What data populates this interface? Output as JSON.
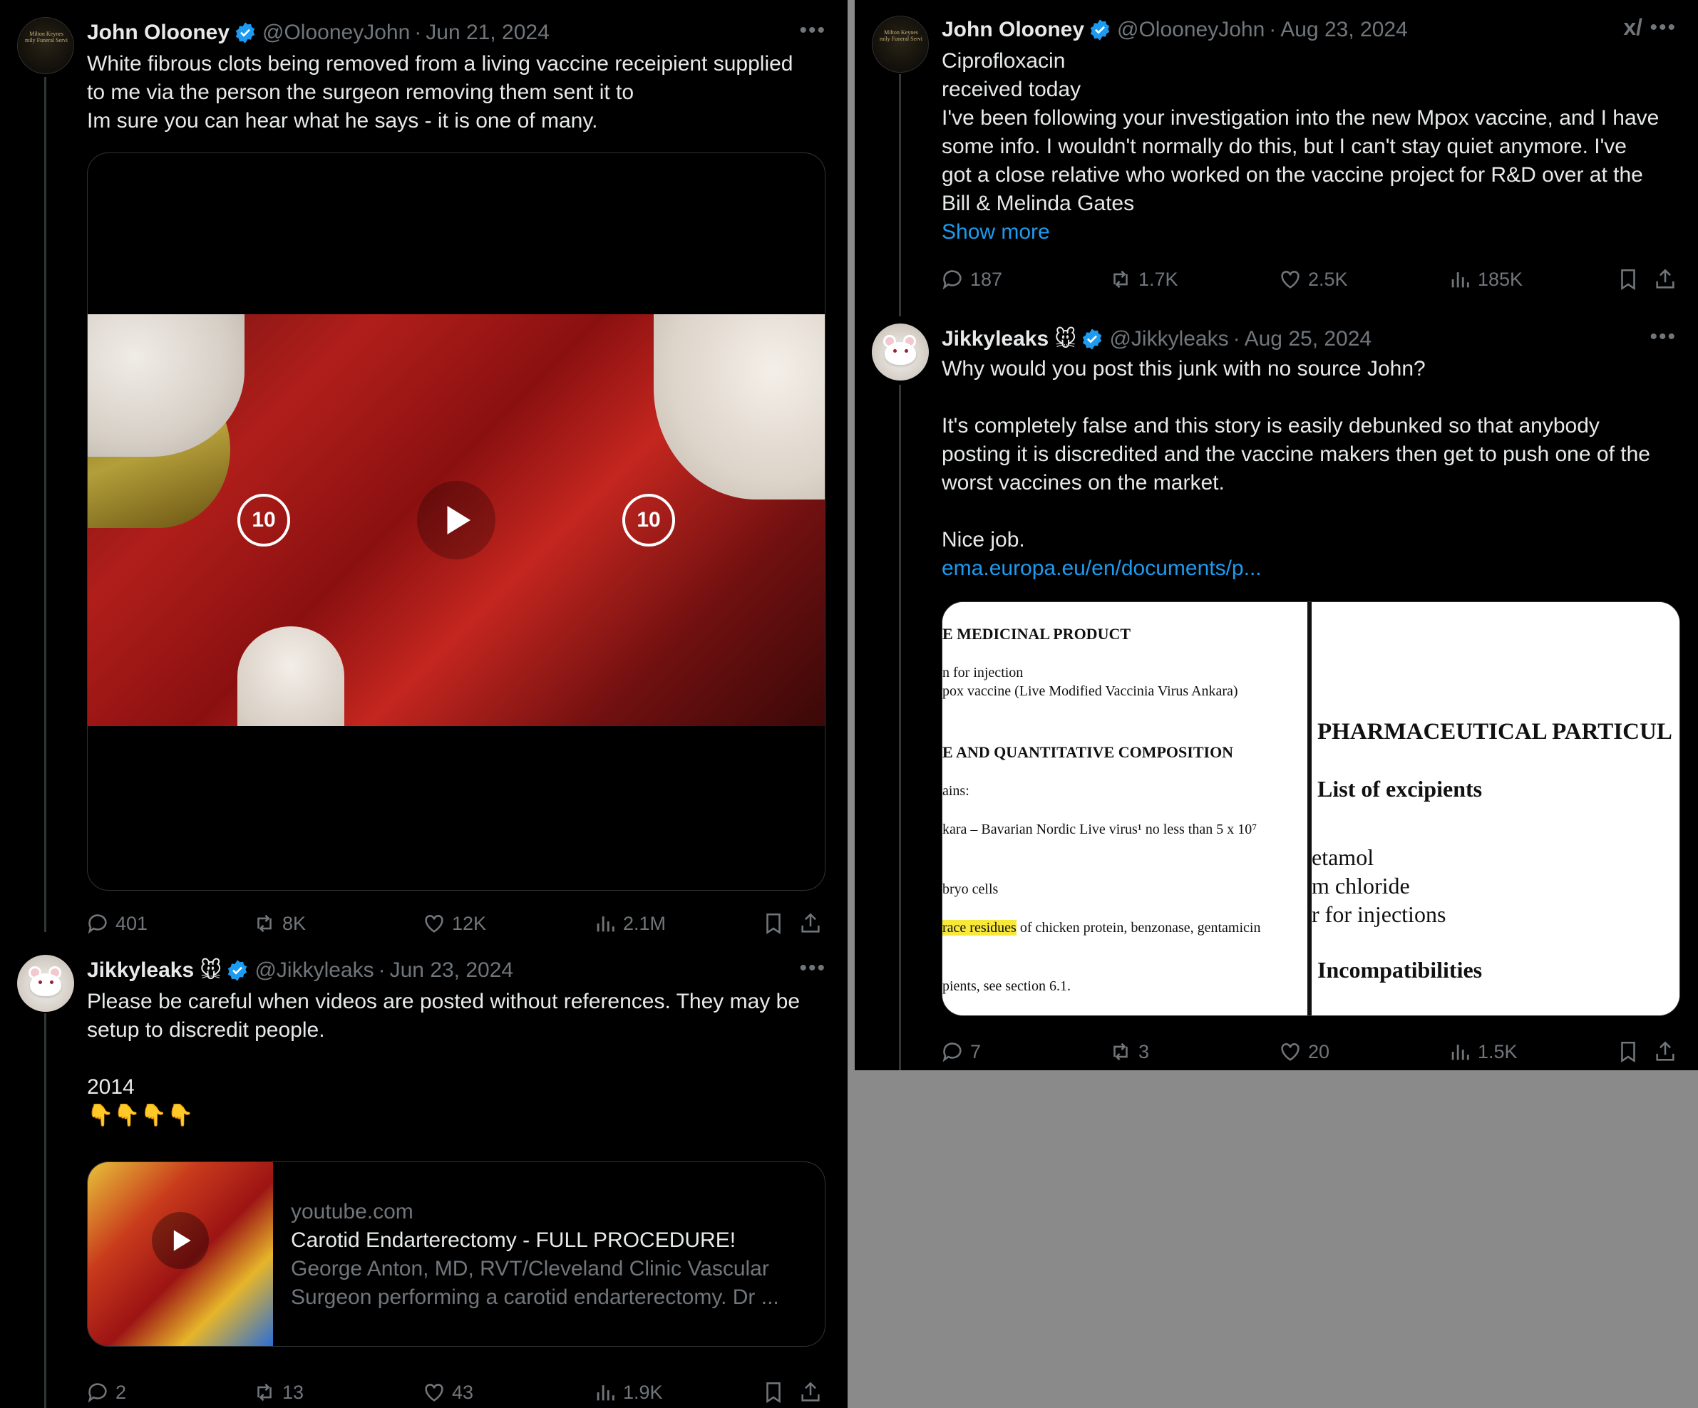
{
  "colors": {
    "background": "#000000",
    "text": "#e7e9ea",
    "muted": "#71767b",
    "link": "#1d9bf0",
    "verified": "#1d9bf0",
    "outside": "#8a8a8a"
  },
  "left": {
    "tweet1": {
      "name": "John Olooney",
      "handle": "@OlooneyJohn",
      "date": "Jun 21, 2024",
      "text": "White fibrous clots being removed from a living vaccine receipient supplied\nto me via the person the surgeon removing them sent it to\nIm sure you can hear what he says - it is one of many.",
      "video": {
        "rewind_label": "10",
        "forward_label": "10"
      },
      "stats": {
        "replies": "401",
        "reposts": "8K",
        "likes": "12K",
        "views": "2.1M"
      },
      "avatar_text": "Milton Keynes\nmily Funeral Servi"
    },
    "tweet2": {
      "name": "Jikkyleaks",
      "emoji": "🐭",
      "handle": "@Jikkyleaks",
      "date": "Jun 23, 2024",
      "text": "Please be careful when videos are posted without references. They may be\nsetup to discredit people.\n\n2014\n👇👇👇👇",
      "card": {
        "domain": "youtube.com",
        "title": "Carotid Endarterectomy - FULL PROCEDURE!",
        "description": "George Anton, MD, RVT/Cleveland Clinic Vascular\nSurgeon performing a carotid endarterectomy. Dr ..."
      },
      "stats": {
        "replies": "2",
        "reposts": "13",
        "likes": "43",
        "views": "1.9K"
      }
    }
  },
  "right": {
    "tweet1": {
      "name": "John Olooney",
      "handle": "@OlooneyJohn",
      "date": "Aug 23, 2024",
      "text": "Ciprofloxacin\nreceived today\nI've been following your investigation into the new Mpox vaccine, and I have\nsome info. I wouldn't normally do this, but I can't stay quiet anymore. I've\ngot a close relative who worked on the vaccine project for R&D over at the\nBill & Melinda Gates",
      "show_more": "Show more",
      "stats": {
        "replies": "187",
        "reposts": "1.7K",
        "likes": "2.5K",
        "views": "185K"
      }
    },
    "tweet2": {
      "name": "Jikkyleaks",
      "emoji": "🐭",
      "handle": "@Jikkyleaks",
      "date": "Aug 25, 2024",
      "text": "Why would you post this junk with no source John?\n\nIt's completely false and this story is easily debunked so that anybody\nposting it is discredited and the vaccine makers then get to push one of the\nworst vaccines on the market.\n\nNice job.",
      "link": "ema.europa.eu/en/documents/p...",
      "doc_left": {
        "l1": "E MEDICINAL PRODUCT",
        "l2": "n for injection",
        "l3": "pox vaccine (Live Modified Vaccinia Virus Ankara)",
        "l4": "E AND QUANTITATIVE COMPOSITION",
        "l5": "ains:",
        "l6": "kara – Bavarian Nordic Live virus¹ no less than 5 x 10⁷",
        "l7": "bryo cells",
        "l8_hl": "race residues",
        "l8_rest": " of chicken protein, benzonase, gentamicin",
        "l9": "pients, see section 6.1."
      },
      "doc_right": {
        "r1": "PHARMACEUTICAL PARTICUL",
        "r2": "List of excipients",
        "r3": "etamol",
        "r4": "m chloride",
        "r5": "r for injections",
        "r6": "Incompatibilities"
      },
      "stats": {
        "replies": "7",
        "reposts": "3",
        "likes": "20",
        "views": "1.5K"
      }
    }
  }
}
